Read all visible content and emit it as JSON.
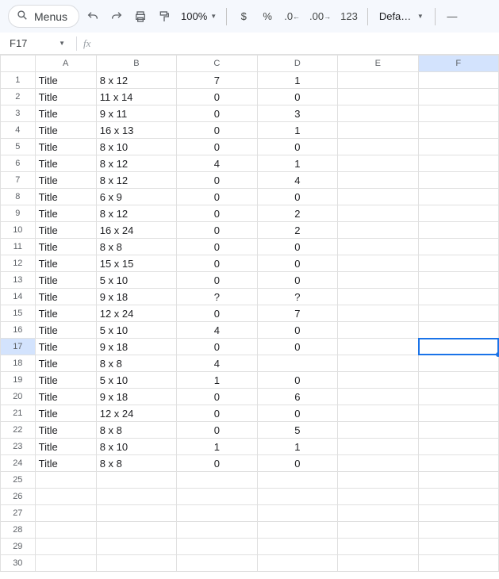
{
  "toolbar": {
    "menus_label": "Menus",
    "zoom": "100%",
    "currency": "$",
    "percent": "%",
    "dec_dec": ".0",
    "dec_inc": ".00",
    "num_format": "123",
    "font": "Defaul…",
    "minus": "—"
  },
  "namebox": {
    "ref": "F17",
    "fx_label": "fx"
  },
  "columns": [
    "A",
    "B",
    "C",
    "D",
    "E",
    "F"
  ],
  "selected": {
    "col": "F",
    "row": 17
  },
  "rows_total": 30,
  "data": [
    {
      "A": "Title",
      "B": "8 x 12",
      "C": "7",
      "D": "1"
    },
    {
      "A": "Title",
      "B": "11 x 14",
      "C": "0",
      "D": "0"
    },
    {
      "A": "Title",
      "B": "9 x 11",
      "C": "0",
      "D": "3"
    },
    {
      "A": "Title",
      "B": "16 x 13",
      "C": "0",
      "D": "1"
    },
    {
      "A": "Title",
      "B": "8 x 10",
      "C": "0",
      "D": "0"
    },
    {
      "A": "Title",
      "B": "8 x 12",
      "C": "4",
      "D": "1"
    },
    {
      "A": "Title",
      "B": "8 x 12",
      "C": "0",
      "D": "4"
    },
    {
      "A": "Title",
      "B": "6 x 9",
      "C": "0",
      "D": "0"
    },
    {
      "A": "Title",
      "B": "8 x 12",
      "C": "0",
      "D": "2"
    },
    {
      "A": "Title",
      "B": "16 x 24",
      "C": "0",
      "D": "2"
    },
    {
      "A": "Title",
      "B": "8  x 8",
      "C": "0",
      "D": "0"
    },
    {
      "A": "Title",
      "B": "15 x 15",
      "C": "0",
      "D": "0"
    },
    {
      "A": "Title",
      "B": "5 x 10",
      "C": "0",
      "D": "0"
    },
    {
      "A": "Title",
      "B": "9 x 18",
      "C": "?",
      "D": "?"
    },
    {
      "A": "Title",
      "B": "12 x 24",
      "C": "0",
      "D": "7"
    },
    {
      "A": "Title",
      "B": "5 x 10",
      "C": "4",
      "D": "0"
    },
    {
      "A": "Title",
      "B": "9 x 18",
      "C": "0",
      "D": "0"
    },
    {
      "A": "Title",
      "B": "8 x 8",
      "C": "4",
      "D": ""
    },
    {
      "A": "Title",
      "B": "5 x 10",
      "C": "1",
      "D": "0"
    },
    {
      "A": "Title",
      "B": "9 x 18",
      "C": "0",
      "D": "6"
    },
    {
      "A": "Title",
      "B": "12 x 24",
      "C": "0",
      "D": "0"
    },
    {
      "A": "Title",
      "B": "8 x 8",
      "C": "0",
      "D": "5"
    },
    {
      "A": "Title",
      "B": "8 x 10",
      "C": "1",
      "D": "1"
    },
    {
      "A": "Title",
      "B": "8 x 8",
      "C": "0",
      "D": "0"
    }
  ]
}
